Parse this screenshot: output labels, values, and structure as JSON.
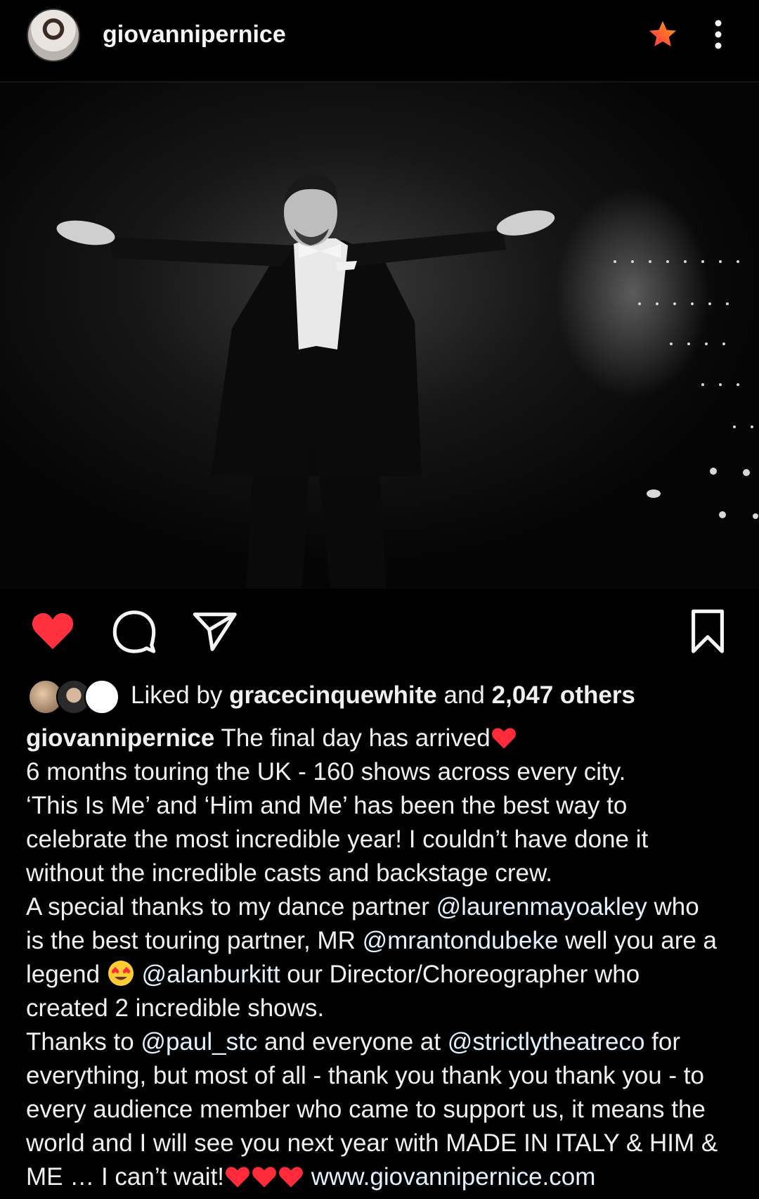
{
  "header": {
    "username": "giovannipernice",
    "avatar": "avatar",
    "favorite_icon": "star-icon",
    "more_icon": "more-vertical-icon"
  },
  "post": {
    "image": "photo-performer-on-stage",
    "actions": {
      "like_icon": "heart-filled-icon",
      "comment_icon": "comment-icon",
      "share_icon": "send-icon",
      "save_icon": "bookmark-icon"
    },
    "likes": {
      "prefix": "Liked by",
      "user": "gracecinquewhite",
      "and": "and",
      "others": "2,047 others"
    },
    "caption": {
      "username": "giovannipernice",
      "l1": " The final day has arrived",
      "l2": "6 months touring the UK - 160 shows across every city.",
      "l3": "‘This Is Me’ and ‘Him and Me’ has been the best way to",
      "l4": "celebrate the most incredible year! I couldn’t have done it",
      "l5": "without the incredible casts and backstage crew.",
      "l6a": "A special thanks to my dance partner ",
      "m1": "@laurenmayoakley",
      "l6b": " who",
      "l7a": "is the best touring partner, MR ",
      "m2": "@mrantondubeke",
      "l7b": " well you are a",
      "l8a": "legend ",
      "m3": "@alanburkitt",
      "l8b": " our Director/Choreographer who",
      "l9": "created 2 incredible shows.",
      "l10a": "Thanks to ",
      "m4": "@paul_stc",
      "l10b": " and everyone at ",
      "m5": "@strictlytheatreco",
      "l10c": " for",
      "l11": "everything, but most of all - thank you thank you thank you - to",
      "l12": "every audience member who came to support us, it means the",
      "l13": "world and I will see you next year with MADE IN ITALY &  HIM &",
      "l14a": "ME … I can’t wait!",
      "link": "www.giovannipernice.com"
    },
    "colors": {
      "like": "#ff3040",
      "mention": "#e0f1ff"
    }
  }
}
